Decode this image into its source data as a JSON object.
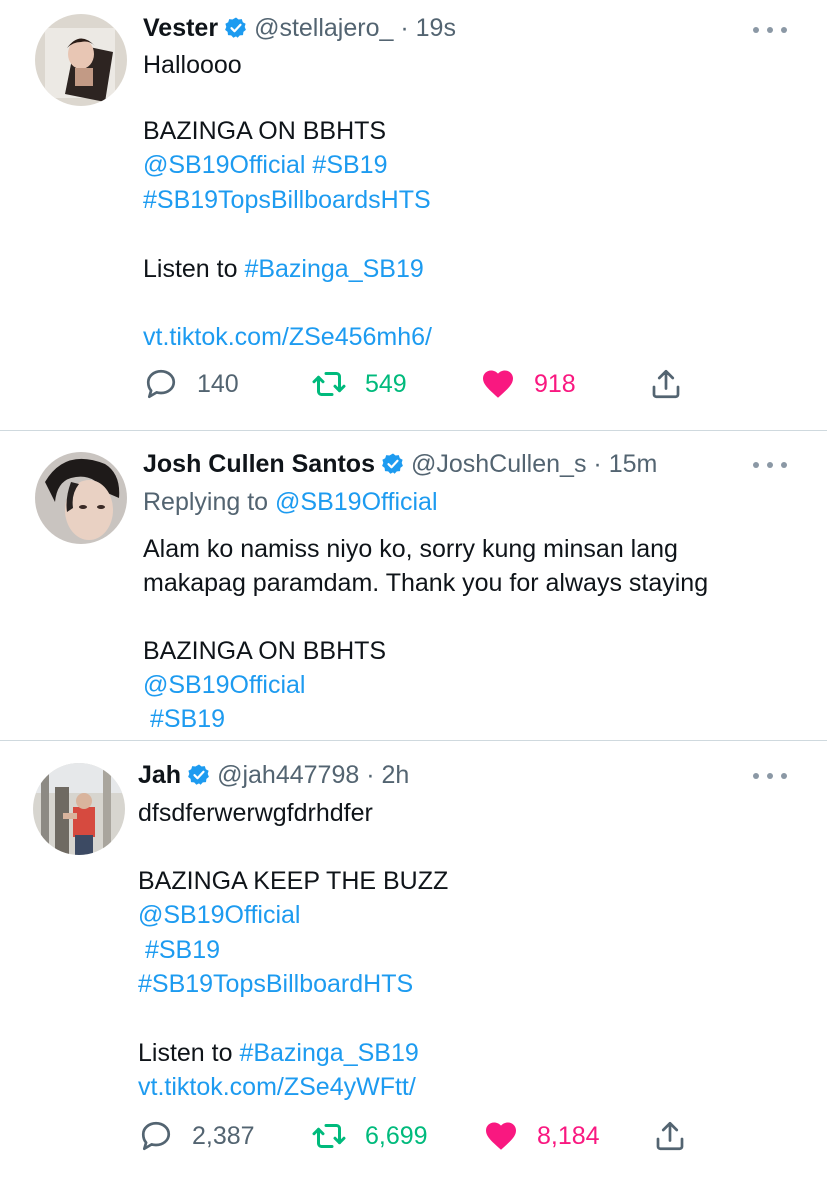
{
  "tweets": [
    {
      "name": "Vester",
      "handle": "@stellajero_",
      "separator": "·",
      "time": "19s",
      "lines": [
        {
          "parts": [
            {
              "text": "Halloooo",
              "link": false
            }
          ]
        },
        {
          "parts": [
            {
              "text": "BAZINGA ON BBHTS",
              "link": false
            }
          ]
        },
        {
          "parts": [
            {
              "text": "@SB19Official #SB19",
              "link": true
            }
          ]
        },
        {
          "parts": [
            {
              "text": "#SB19TopsBillboardsHTS",
              "link": true
            }
          ]
        },
        {
          "parts": [
            {
              "text": "Listen to ",
              "link": false
            },
            {
              "text": "#Bazinga_SB19",
              "link": true
            }
          ]
        },
        {
          "parts": [
            {
              "text": "vt.tiktok.com/ZSe456mh6/",
              "link": true
            }
          ]
        }
      ],
      "counts": {
        "replies": "140",
        "retweets": "549",
        "likes": "918"
      }
    },
    {
      "name": "Josh Cullen Santos",
      "handle": "@JoshCullen_s",
      "separator": "·",
      "time": "15m",
      "replying_label": "Replying to ",
      "replying_to": "@SB19Official",
      "lines": [
        {
          "parts": [
            {
              "text": "Alam ko namiss niyo ko, sorry kung minsan lang",
              "link": false
            }
          ]
        },
        {
          "parts": [
            {
              "text": "makapag paramdam. Thank you for always staying",
              "link": false
            }
          ]
        },
        {
          "parts": [
            {
              "text": "BAZINGA ON BBHTS",
              "link": false
            }
          ]
        },
        {
          "parts": [
            {
              "text": "@SB19Official",
              "link": true
            }
          ]
        },
        {
          "parts": [
            {
              "text": " #SB19",
              "link": true
            }
          ]
        }
      ]
    },
    {
      "name": "Jah",
      "handle": "@jah447798",
      "separator": "·",
      "time": "2h",
      "lines": [
        {
          "parts": [
            {
              "text": "dfsdferwerwgfdrhdfer",
              "link": false
            }
          ]
        },
        {
          "parts": [
            {
              "text": "BAZINGA KEEP THE BUZZ",
              "link": false
            }
          ]
        },
        {
          "parts": [
            {
              "text": "@SB19Official",
              "link": true
            }
          ]
        },
        {
          "parts": [
            {
              "text": " #SB19",
              "link": true
            }
          ]
        },
        {
          "parts": [
            {
              "text": "#SB19TopsBillboardHTS",
              "link": true
            }
          ]
        },
        {
          "parts": [
            {
              "text": "Listen to ",
              "link": false
            },
            {
              "text": "#Bazinga_SB19",
              "link": true
            }
          ]
        },
        {
          "parts": [
            {
              "text": "vt.tiktok.com/ZSe4yWFtt/",
              "link": true
            }
          ]
        }
      ],
      "counts": {
        "replies": "2,387",
        "retweets": "6,699",
        "likes": "8,184"
      }
    }
  ],
  "icons": {
    "verified": "verified-badge-icon",
    "more": "more-dots-icon",
    "reply": "reply-bubble-icon",
    "retweet": "retweet-icon",
    "like": "heart-icon",
    "share": "share-icon"
  },
  "colors": {
    "link": "#1d9bf0",
    "muted": "#536471",
    "retweet": "#00ba7c",
    "like": "#f91880",
    "verified": "#1d9bf0"
  }
}
